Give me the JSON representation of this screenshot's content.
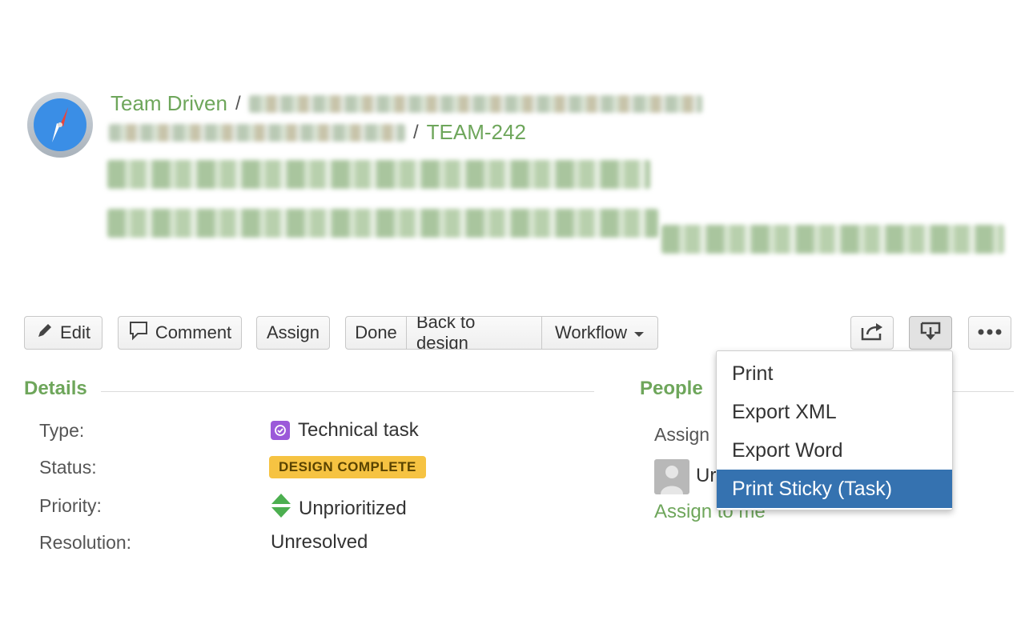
{
  "breadcrumb": {
    "project": "Team Driven",
    "separator": "/",
    "issue_key": "TEAM-242"
  },
  "toolbar": {
    "edit": "Edit",
    "comment": "Comment",
    "assign": "Assign",
    "done": "Done",
    "back_to_design": "Back to design",
    "workflow": "Workflow"
  },
  "details": {
    "title": "Details",
    "type_label": "Type:",
    "type_value": "Technical task",
    "status_label": "Status:",
    "status_value": "DESIGN COMPLETE",
    "priority_label": "Priority:",
    "priority_value": "Unprioritized",
    "resolution_label": "Resolution:",
    "resolution_value": "Unresolved"
  },
  "people": {
    "title": "People",
    "assignee_label": "Assign",
    "assignee_value": "Ur",
    "assign_to_me": "Assign to me"
  },
  "export_menu": {
    "items": [
      "Print",
      "Export XML",
      "Export Word",
      "Print Sticky (Task)"
    ],
    "selected": "Print Sticky (Task)"
  },
  "colors": {
    "link_green": "#6ea65b",
    "status_yellow": "#f6c342",
    "menu_highlight": "#3572b0"
  }
}
